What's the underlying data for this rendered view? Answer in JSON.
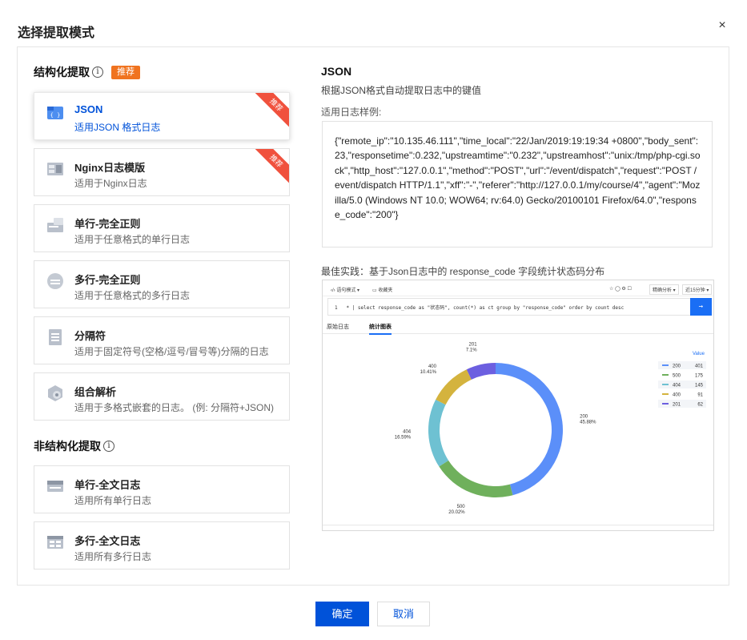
{
  "dialog": {
    "title": "选择提取模式",
    "close_icon": "×"
  },
  "structured": {
    "heading": "结构化提取",
    "info_icon": "i",
    "tag": "推荐",
    "items": [
      {
        "name": "JSON",
        "desc": "适用JSON 格式日志",
        "icon": "json-icon",
        "ribbon": "推荐"
      },
      {
        "name": "Nginx日志模版",
        "desc": "适用于Nginx日志",
        "icon": "nginx-icon",
        "ribbon": "推荐"
      },
      {
        "name": "单行-完全正则",
        "desc": "适用于任意格式的单行日志",
        "icon": "single-line-regex-icon"
      },
      {
        "name": "多行-完全正则",
        "desc": "适用于任意格式的多行日志",
        "icon": "multi-line-regex-icon"
      },
      {
        "name": "分隔符",
        "desc": "适用于固定符号(空格/逗号/冒号等)分隔的日志",
        "icon": "delimiter-icon"
      },
      {
        "name": "组合解析",
        "desc": "适用于多格式嵌套的日志。 (例: 分隔符+JSON)",
        "icon": "combined-parse-icon"
      }
    ]
  },
  "unstructured": {
    "heading": "非结构化提取",
    "info_icon": "i",
    "items": [
      {
        "name": "单行-全文日志",
        "desc": "适用所有单行日志",
        "icon": "single-line-full-text-icon"
      },
      {
        "name": "多行-全文日志",
        "desc": "适用所有多行日志",
        "icon": "multi-line-full-text-icon"
      }
    ]
  },
  "detail": {
    "title": "JSON",
    "subtitle": "根据JSON格式自动提取日志中的键值",
    "sample_label": "适用日志样例:",
    "sample": "{\"remote_ip\":\"10.135.46.111\",\"time_local\":\"22/Jan/2019:19:19:34 +0800\",\"body_sent\":23,\"responsetime\":0.232,\"upstreamtime\":\"0.232\",\"upstreamhost\":\"unix:/tmp/php-cgi.sock\",\"http_host\":\"127.0.0.1\",\"method\":\"POST\",\"url\":\"/event/dispatch\",\"request\":\"POST /event/dispatch HTTP/1.1\",\"xff\":\"-\",\"referer\":\"http://127.0.0.1/my/course/4\",\"agent\":\"Mozilla/5.0 (Windows NT 10.0; WOW64; rv:64.0) Gecko/20100101 Firefox/64.0\",\"response_code\":\"200\"}",
    "best_practice": "最佳实践：基于Json日志中的 response_code 字段统计状态码分布"
  },
  "screenshot": {
    "toolbar_left": "语句模式",
    "toolbar_fav": "收藏夹",
    "toolbar_analyze": "精确分析",
    "toolbar_time": "近15分钟",
    "query_line_no": "1",
    "query": "* | select  response_code  as \"状态码\", count(*) as ct group by \"response_code\" order by count desc",
    "tab_raw": "原始日志",
    "tab_chart": "统计图表"
  },
  "chart_data": {
    "type": "pie",
    "labels": [
      "200",
      "500",
      "404",
      "400",
      "201"
    ],
    "values": [
      401,
      175,
      145,
      91,
      62
    ],
    "percent_labels": [
      "45.88%",
      "20.02%",
      "16.59%",
      "10.41%",
      "7.1%"
    ],
    "colors": [
      "#5b8ff9",
      "#6fb05c",
      "#6ec1d2",
      "#d4b33e",
      "#6c5fe0"
    ],
    "legend_title": "Value",
    "legend_position": "top-right",
    "donut": true
  },
  "footer": {
    "ok": "确定",
    "cancel": "取消"
  }
}
